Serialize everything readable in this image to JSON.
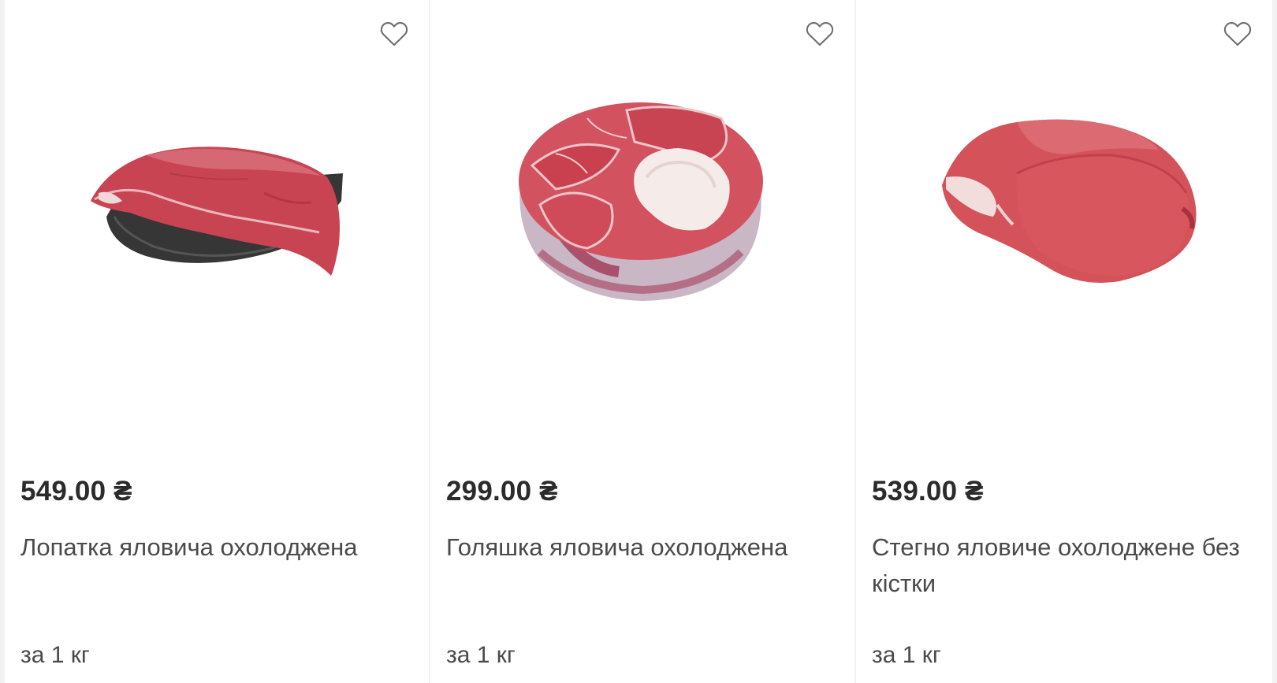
{
  "products": [
    {
      "price": "549.00 ₴",
      "name": "Лопатка яловича охолоджена",
      "unit": "за 1 кг",
      "favorite_icon": "heart-outline-icon",
      "image": "beef-shoulder-photo"
    },
    {
      "price": "299.00 ₴",
      "name": "Голяшка яловича охолоджена",
      "unit": "за 1 кг",
      "favorite_icon": "heart-outline-icon",
      "image": "beef-shank-photo"
    },
    {
      "price": "539.00 ₴",
      "name": "Стегно яловиче охолоджене без кістки",
      "unit": "за 1 кг",
      "favorite_icon": "heart-outline-icon",
      "image": "beef-thigh-photo"
    }
  ],
  "colors": {
    "meat_red": "#c4414f",
    "meat_light": "#d9606c",
    "fat": "#f1e6e4",
    "tray": "#3a3a3a",
    "text": "#2b2b2b",
    "divider": "#f2f2f2"
  }
}
